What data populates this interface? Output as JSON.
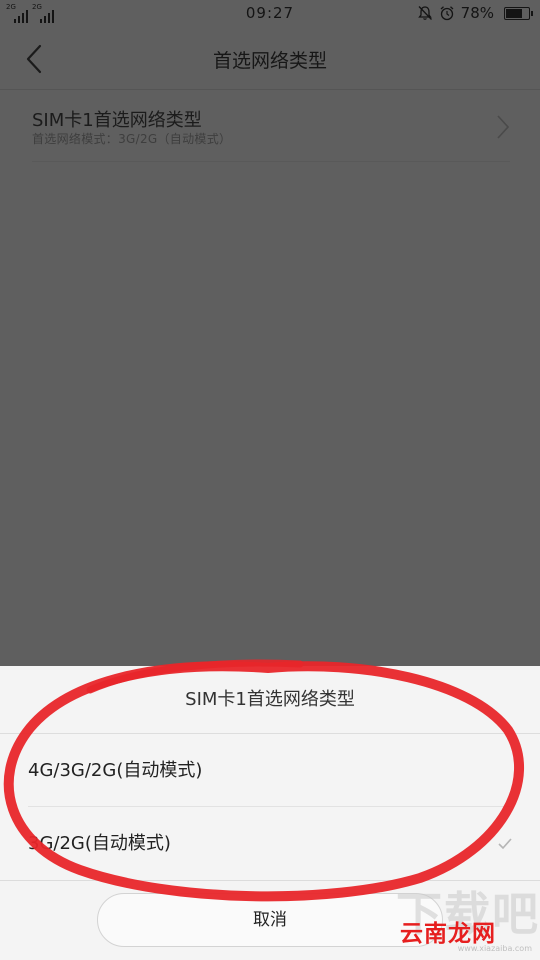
{
  "status_bar": {
    "sim1_type": "2G",
    "sim2_type": "2G",
    "time": "09:27",
    "battery": "78%",
    "battery_level": 0.78,
    "icons": [
      "signal-icon",
      "signal-icon",
      "mute-bell-icon",
      "alarm-icon",
      "battery-icon"
    ]
  },
  "header": {
    "title": "首选网络类型",
    "back_icon": "chevron-left-icon"
  },
  "settings": {
    "item": {
      "title": "SIM卡1首选网络类型",
      "subtitle": "首选网络模式：3G/2G（自动模式）",
      "chevron_icon": "chevron-right-icon"
    }
  },
  "sheet": {
    "title": "SIM卡1首选网络类型",
    "options": [
      {
        "label": "4G/3G/2G(自动模式)"
      },
      {
        "label": "3G/2G(自动模式)",
        "selected": true
      }
    ],
    "cancel": "取消"
  },
  "annotation": {
    "color": "#e8262a",
    "shape": "hand-drawn-circle"
  },
  "watermark": {
    "big": "下载吧",
    "brand": "云南龙网",
    "url": "www.xiazaiba.com",
    "color": "#e61f1f"
  },
  "colors": {
    "dim_overlay": "#5f5f5f",
    "sheet_bg": "#f4f4f4"
  }
}
